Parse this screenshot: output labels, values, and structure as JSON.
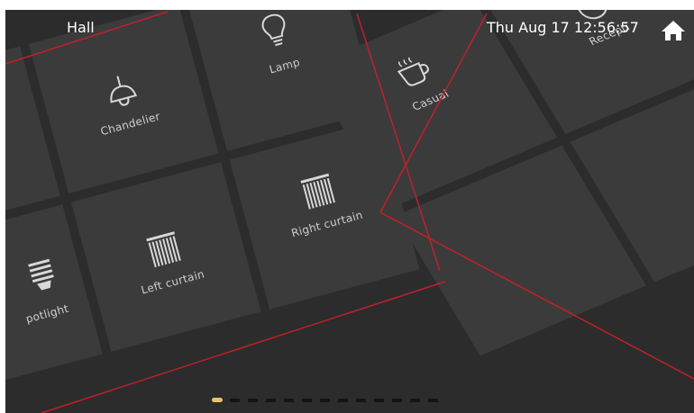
{
  "header": {
    "room": "Hall",
    "datetime": "Thu Aug 17  12:56:57"
  },
  "icons": {
    "home": "home-icon",
    "chandelier": "chandelier-icon",
    "lamp": "lightbulb-icon",
    "curtain": "curtain-icon",
    "spotlight": "cfl-bulb-icon",
    "casual": "coffee-cup-icon",
    "reception": "reception-icon"
  },
  "devices": [
    {
      "label": "Chandelier"
    },
    {
      "label": "Lamp"
    },
    {
      "label": "potlight"
    },
    {
      "label": "Left curtain"
    },
    {
      "label": "Right curtain"
    }
  ],
  "scenes": [
    {
      "label": "Casual"
    },
    {
      "label": "Recepti"
    }
  ],
  "pager": {
    "page_count": 13,
    "active_index": 0
  },
  "colors": {
    "background": "#2c2c2c",
    "tile": "#3b3b3b",
    "guide_line": "#c0202a",
    "active_page": "#e9c26b"
  }
}
